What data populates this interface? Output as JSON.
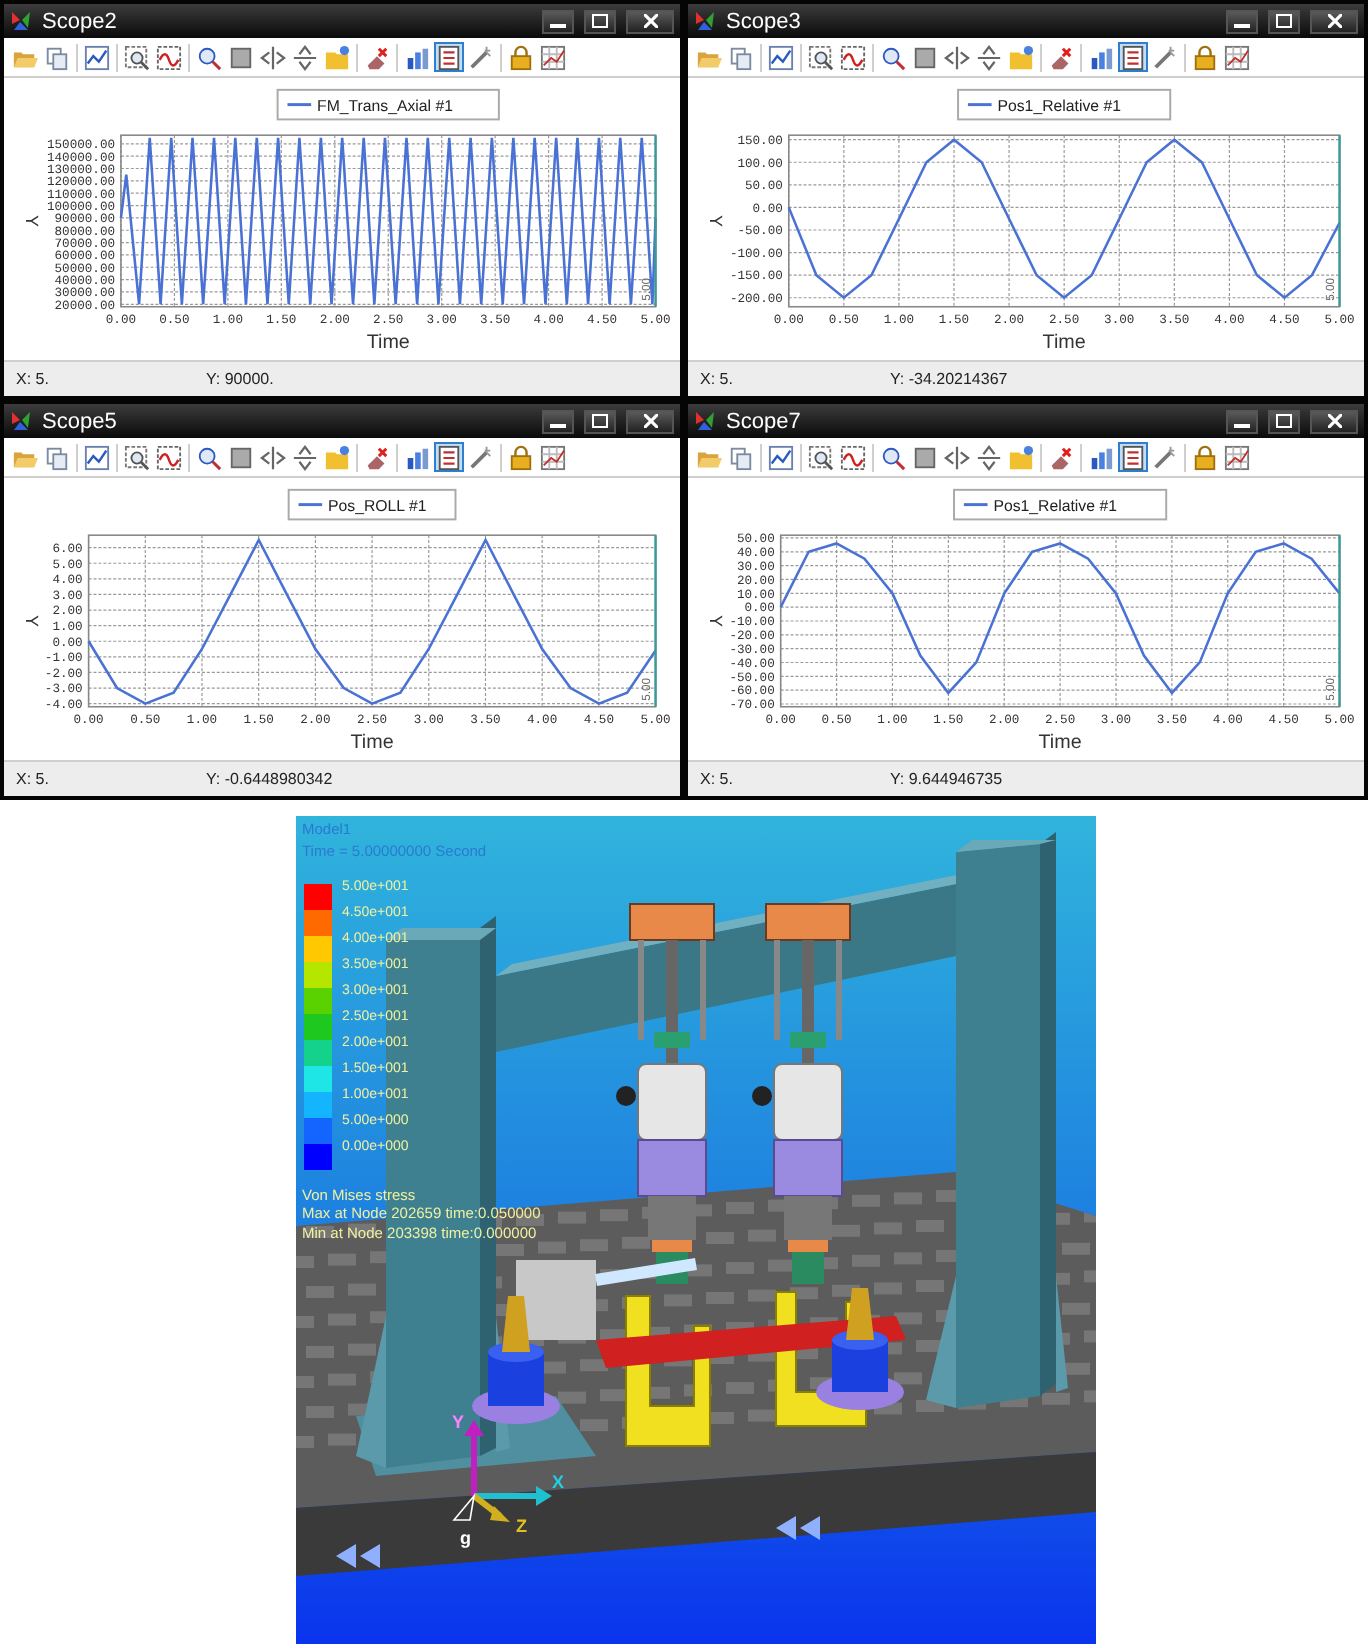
{
  "toolbar": [
    {
      "kind": "open",
      "selected": false
    },
    {
      "kind": "copy",
      "selected": false
    },
    {
      "kind": "separator"
    },
    {
      "kind": "line-chart",
      "selected": false
    },
    {
      "kind": "separator"
    },
    {
      "kind": "zoom-box",
      "selected": false
    },
    {
      "kind": "wave-box",
      "selected": false
    },
    {
      "kind": "separator"
    },
    {
      "kind": "data-zoom",
      "selected": false
    },
    {
      "kind": "square",
      "selected": false
    },
    {
      "kind": "flip-h",
      "selected": false
    },
    {
      "kind": "flip-v",
      "selected": false
    },
    {
      "kind": "folder-note",
      "selected": false
    },
    {
      "kind": "separator"
    },
    {
      "kind": "eraser",
      "selected": false
    },
    {
      "kind": "separator"
    },
    {
      "kind": "bar-chart",
      "selected": false
    },
    {
      "kind": "list",
      "selected": true
    },
    {
      "kind": "wand",
      "selected": false
    },
    {
      "kind": "separator"
    },
    {
      "kind": "lock",
      "selected": false
    },
    {
      "kind": "grid-chart",
      "selected": false
    }
  ],
  "scopes": [
    {
      "title": "Scope2",
      "cursor_label": "5.00",
      "status_x": "X: 5.",
      "status_y": "Y: 90000.",
      "chart_data": {
        "type": "line",
        "xlabel": "Time",
        "ylabel": "Y",
        "x": [
          0,
          0.05,
          0.17,
          0.27,
          0.37,
          0.47,
          0.57,
          0.67,
          0.77,
          0.87,
          0.97,
          1.07,
          1.17,
          1.27,
          1.37,
          1.47,
          1.57,
          1.67,
          1.77,
          1.87,
          1.97,
          2.07,
          2.17,
          2.27,
          2.37,
          2.47,
          2.57,
          2.67,
          2.77,
          2.87,
          2.97,
          3.07,
          3.17,
          3.27,
          3.37,
          3.47,
          3.57,
          3.67,
          3.77,
          3.87,
          3.97,
          4.07,
          4.17,
          4.27,
          4.37,
          4.47,
          4.57,
          4.67,
          4.77,
          4.87,
          4.97,
          5
        ],
        "series": [
          {
            "name": "FM_Trans_Axial #1",
            "color": "#4a72d4",
            "values": [
              90000,
              125000,
              20000,
              155000,
              20000,
              155000,
              20000,
              155000,
              20000,
              155000,
              20000,
              155000,
              20000,
              155000,
              20000,
              155000,
              20000,
              155000,
              20000,
              155000,
              20000,
              155000,
              20000,
              155000,
              20000,
              155000,
              20000,
              155000,
              20000,
              155000,
              20000,
              155000,
              20000,
              155000,
              20000,
              155000,
              20000,
              155000,
              20000,
              155000,
              20000,
              155000,
              20000,
              155000,
              20000,
              155000,
              20000,
              155000,
              20000,
              155000,
              20000,
              90000
            ]
          }
        ],
        "xlim": [
          0,
          5
        ],
        "ylim": [
          18000,
          157000
        ],
        "grid": true,
        "xticks": [
          {
            "value": 0,
            "label": "0.00"
          },
          {
            "value": 0.5,
            "label": "0.50"
          },
          {
            "value": 1,
            "label": "1.00"
          },
          {
            "value": 1.5,
            "label": "1.50"
          },
          {
            "value": 2,
            "label": "2.00"
          },
          {
            "value": 2.5,
            "label": "2.50"
          },
          {
            "value": 3,
            "label": "3.00"
          },
          {
            "value": 3.5,
            "label": "3.50"
          },
          {
            "value": 4,
            "label": "4.00"
          },
          {
            "value": 4.5,
            "label": "4.50"
          },
          {
            "value": 5,
            "label": "5.00"
          }
        ],
        "yticks": [
          {
            "value": 20000,
            "label": "20000.00"
          },
          {
            "value": 30000,
            "label": "30000.00"
          },
          {
            "value": 40000,
            "label": "40000.00"
          },
          {
            "value": 50000,
            "label": "50000.00"
          },
          {
            "value": 60000,
            "label": "60000.00"
          },
          {
            "value": 70000,
            "label": "70000.00"
          },
          {
            "value": 80000,
            "label": "80000.00"
          },
          {
            "value": 90000,
            "label": "90000.00"
          },
          {
            "value": 100000,
            "label": "100000.00"
          },
          {
            "value": 110000,
            "label": "110000.00"
          },
          {
            "value": 120000,
            "label": "120000.00"
          },
          {
            "value": 130000,
            "label": "130000.00"
          },
          {
            "value": 140000,
            "label": "140000.00"
          },
          {
            "value": 150000,
            "label": "150000.00"
          }
        ]
      }
    },
    {
      "title": "Scope3",
      "cursor_label": "5.00",
      "status_x": "X: 5.",
      "status_y": "Y: -34.20214367",
      "chart_data": {
        "type": "line",
        "xlabel": "Time",
        "ylabel": "Y",
        "x": [
          0,
          0.25,
          0.5,
          0.75,
          1,
          1.25,
          1.5,
          1.75,
          2,
          2.25,
          2.5,
          2.75,
          3,
          3.25,
          3.5,
          3.75,
          4,
          4.25,
          4.5,
          4.75,
          5
        ],
        "series": [
          {
            "name": "Pos1_Relative #1",
            "color": "#4a72d4",
            "values": [
              0,
              -150,
              -200,
              -150,
              -25,
              100,
              150,
              100,
              -25,
              -150,
              -200,
              -150,
              -25,
              100,
              150,
              100,
              -25,
              -150,
              -200,
              -150,
              -34
            ]
          }
        ],
        "xlim": [
          0,
          5
        ],
        "ylim": [
          -220,
          160
        ],
        "grid": true,
        "xticks": [
          {
            "value": 0,
            "label": "0.00"
          },
          {
            "value": 0.5,
            "label": "0.50"
          },
          {
            "value": 1,
            "label": "1.00"
          },
          {
            "value": 1.5,
            "label": "1.50"
          },
          {
            "value": 2,
            "label": "2.00"
          },
          {
            "value": 2.5,
            "label": "2.50"
          },
          {
            "value": 3,
            "label": "3.00"
          },
          {
            "value": 3.5,
            "label": "3.50"
          },
          {
            "value": 4,
            "label": "4.00"
          },
          {
            "value": 4.5,
            "label": "4.50"
          },
          {
            "value": 5,
            "label": "5.00"
          }
        ],
        "yticks": [
          {
            "value": -200,
            "label": "-200.00"
          },
          {
            "value": -150,
            "label": "-150.00"
          },
          {
            "value": -100,
            "label": "-100.00"
          },
          {
            "value": -50,
            "label": "-50.00"
          },
          {
            "value": 0,
            "label": "0.00"
          },
          {
            "value": 50,
            "label": "50.00"
          },
          {
            "value": 100,
            "label": "100.00"
          },
          {
            "value": 150,
            "label": "150.00"
          }
        ]
      }
    },
    {
      "title": "Scope5",
      "cursor_label": "5.00",
      "status_x": "X: 5.",
      "status_y": "Y: -0.6448980342",
      "chart_data": {
        "type": "line",
        "xlabel": "Time",
        "ylabel": "Y",
        "x": [
          0,
          0.25,
          0.5,
          0.75,
          1,
          1.25,
          1.5,
          1.75,
          2,
          2.25,
          2.5,
          2.75,
          3,
          3.25,
          3.5,
          3.75,
          4,
          4.25,
          4.5,
          4.75,
          5
        ],
        "series": [
          {
            "name": "Pos_ROLL #1",
            "color": "#4a72d4",
            "values": [
              0,
              -3,
              -4,
              -3.3,
              -0.5,
              3,
              6.5,
              3,
              -0.5,
              -3,
              -4,
              -3.3,
              -0.5,
              3,
              6.5,
              3,
              -0.5,
              -3,
              -4,
              -3.3,
              -0.6
            ]
          }
        ],
        "xlim": [
          0,
          5
        ],
        "ylim": [
          -4.2,
          6.8
        ],
        "grid": true,
        "xticks": [
          {
            "value": 0,
            "label": "0.00"
          },
          {
            "value": 0.5,
            "label": "0.50"
          },
          {
            "value": 1,
            "label": "1.00"
          },
          {
            "value": 1.5,
            "label": "1.50"
          },
          {
            "value": 2,
            "label": "2.00"
          },
          {
            "value": 2.5,
            "label": "2.50"
          },
          {
            "value": 3,
            "label": "3.00"
          },
          {
            "value": 3.5,
            "label": "3.50"
          },
          {
            "value": 4,
            "label": "4.00"
          },
          {
            "value": 4.5,
            "label": "4.50"
          },
          {
            "value": 5,
            "label": "5.00"
          }
        ],
        "yticks": [
          {
            "value": -4,
            "label": "-4.00"
          },
          {
            "value": -3,
            "label": "-3.00"
          },
          {
            "value": -2,
            "label": "-2.00"
          },
          {
            "value": -1,
            "label": "-1.00"
          },
          {
            "value": 0,
            "label": "0.00"
          },
          {
            "value": 1,
            "label": "1.00"
          },
          {
            "value": 2,
            "label": "2.00"
          },
          {
            "value": 3,
            "label": "3.00"
          },
          {
            "value": 4,
            "label": "4.00"
          },
          {
            "value": 5,
            "label": "5.00"
          },
          {
            "value": 6,
            "label": "6.00"
          }
        ]
      }
    },
    {
      "title": "Scope7",
      "cursor_label": "5.00",
      "status_x": "X: 5.",
      "status_y": "Y: 9.644946735",
      "chart_data": {
        "type": "line",
        "xlabel": "Time",
        "ylabel": "Y",
        "x": [
          0,
          0.25,
          0.5,
          0.75,
          1,
          1.25,
          1.5,
          1.75,
          2,
          2.25,
          2.5,
          2.75,
          3,
          3.25,
          3.5,
          3.75,
          4,
          4.25,
          4.5,
          4.75,
          5
        ],
        "series": [
          {
            "name": "Pos1_Relative #1",
            "color": "#4a72d4",
            "values": [
              0,
              40,
              46,
              35,
              10,
              -35,
              -62,
              -40,
              10,
              40,
              46,
              35,
              10,
              -35,
              -62,
              -40,
              10,
              40,
              46,
              35,
              10
            ]
          }
        ],
        "xlim": [
          0,
          5
        ],
        "ylim": [
          -72,
          52
        ],
        "grid": true,
        "xticks": [
          {
            "value": 0,
            "label": "0.00"
          },
          {
            "value": 0.5,
            "label": "0.50"
          },
          {
            "value": 1,
            "label": "1.00"
          },
          {
            "value": 1.5,
            "label": "1.50"
          },
          {
            "value": 2,
            "label": "2.00"
          },
          {
            "value": 2.5,
            "label": "2.50"
          },
          {
            "value": 3,
            "label": "3.00"
          },
          {
            "value": 3.5,
            "label": "3.50"
          },
          {
            "value": 4,
            "label": "4.00"
          },
          {
            "value": 4.5,
            "label": "4.50"
          },
          {
            "value": 5,
            "label": "5.00"
          }
        ],
        "yticks": [
          {
            "value": -70,
            "label": "-70.00"
          },
          {
            "value": -60,
            "label": "-60.00"
          },
          {
            "value": -50,
            "label": "-50.00"
          },
          {
            "value": -40,
            "label": "-40.00"
          },
          {
            "value": -30,
            "label": "-30.00"
          },
          {
            "value": -20,
            "label": "-20.00"
          },
          {
            "value": -10,
            "label": "-10.00"
          },
          {
            "value": 0,
            "label": "0.00"
          },
          {
            "value": 10,
            "label": "10.00"
          },
          {
            "value": 20,
            "label": "20.00"
          },
          {
            "value": 30,
            "label": "30.00"
          },
          {
            "value": 40,
            "label": "40.00"
          },
          {
            "value": 50,
            "label": "50.00"
          }
        ]
      }
    }
  ],
  "viewport": {
    "model": "Model1",
    "time": "Time = 5.00000000 Second",
    "legend": [
      {
        "label": "5.00e+001",
        "color": "#ff0000"
      },
      {
        "label": "4.50e+001",
        "color": "#ff6a00"
      },
      {
        "label": "4.00e+001",
        "color": "#ffc800"
      },
      {
        "label": "3.50e+001",
        "color": "#b4e600"
      },
      {
        "label": "3.00e+001",
        "color": "#5ad200"
      },
      {
        "label": "2.50e+001",
        "color": "#1ec81e"
      },
      {
        "label": "2.00e+001",
        "color": "#14d28c"
      },
      {
        "label": "1.50e+001",
        "color": "#1ee6e6"
      },
      {
        "label": "1.00e+001",
        "color": "#14b4ff"
      },
      {
        "label": "5.00e+000",
        "color": "#1464ff"
      },
      {
        "label": "0.00e+000",
        "color": "#0000ff"
      }
    ],
    "result_title": "Von Mises stress",
    "max_info": "Max at Node 202659 time:0.050000",
    "min_info": "Min at Node 203398 time:0.000000",
    "axes": [
      "Y",
      "X",
      "Z",
      "g"
    ]
  }
}
